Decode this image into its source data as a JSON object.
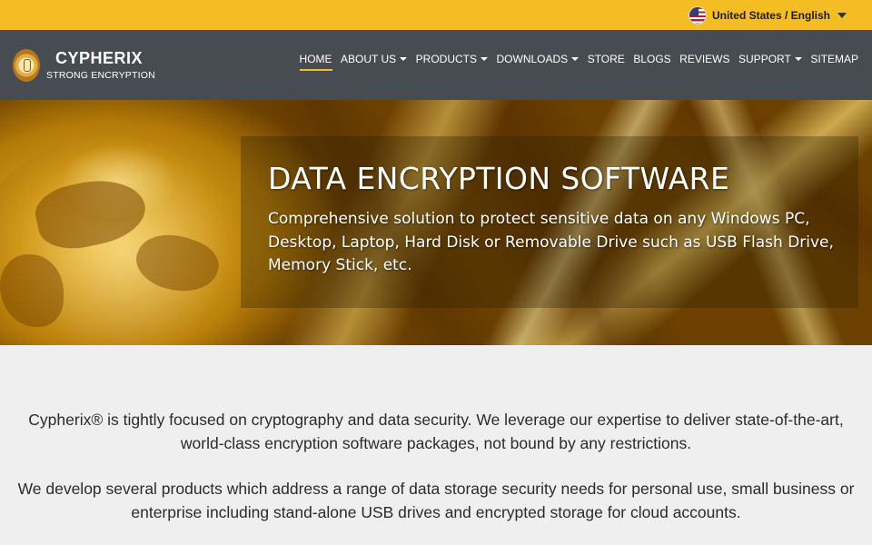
{
  "lang_bar": {
    "selected_language": "United States / English",
    "flag_icon": "us-flag-icon"
  },
  "header": {
    "logo": {
      "title": "CYPHERIX",
      "subtitle": "STRONG ENCRYPTION"
    },
    "nav": [
      {
        "label": "HOME",
        "active": true,
        "dropdown": false
      },
      {
        "label": "ABOUT US",
        "active": false,
        "dropdown": true
      },
      {
        "label": "PRODUCTS",
        "active": false,
        "dropdown": true
      },
      {
        "label": "DOWNLOADS",
        "active": false,
        "dropdown": true
      },
      {
        "label": "STORE",
        "active": false,
        "dropdown": false
      },
      {
        "label": "BLOGS",
        "active": false,
        "dropdown": false
      },
      {
        "label": "REVIEWS",
        "active": false,
        "dropdown": false
      },
      {
        "label": "SUPPORT",
        "active": false,
        "dropdown": true
      },
      {
        "label": "SITEMAP",
        "active": false,
        "dropdown": false
      }
    ]
  },
  "hero": {
    "title": "DATA ENCRYPTION SOFTWARE",
    "description": "Comprehensive solution to protect sensitive data on any Windows PC, Desktop, Laptop, Hard Disk or Removable Drive such as USB Flash Drive, Memory Stick, etc."
  },
  "intro": {
    "paragraph1": "Cypherix® is tightly focused on cryptography and data security. We leverage our expertise to deliver state-of-the-art, world-class encryption software packages, not bound by any restrictions.",
    "paragraph2": "We develop several products which address a range of data storage security needs for personal use, small business or enterprise including stand-alone USB drives and encrypted storage for cloud accounts."
  },
  "colors": {
    "accent": "#f3bd23",
    "header_bg": "#474b52",
    "page_bg": "#efefef"
  }
}
